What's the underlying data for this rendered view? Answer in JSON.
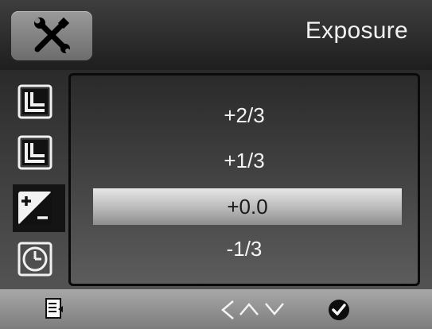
{
  "header": {
    "title": "Exposure",
    "icon": "tools-icon"
  },
  "rail": {
    "items": [
      {
        "icon": "frame-corner-icon",
        "selected": false
      },
      {
        "icon": "frame-corner-icon",
        "selected": false
      },
      {
        "icon": "exposure-compensation-icon",
        "selected": true
      },
      {
        "icon": "clock-icon",
        "selected": false
      }
    ]
  },
  "options": [
    {
      "label": "+2/3",
      "selected": false
    },
    {
      "label": "+1/3",
      "selected": false
    },
    {
      "label": "+0.0",
      "selected": true
    },
    {
      "label": "-1/3",
      "selected": false
    }
  ],
  "footer": {
    "icons": [
      "menu-page-icon",
      "back-icon",
      "up-icon",
      "down-icon",
      "confirm-check-icon"
    ]
  },
  "colors": {
    "highlight": "#c8c8c8",
    "text": "#f4f4f4"
  }
}
